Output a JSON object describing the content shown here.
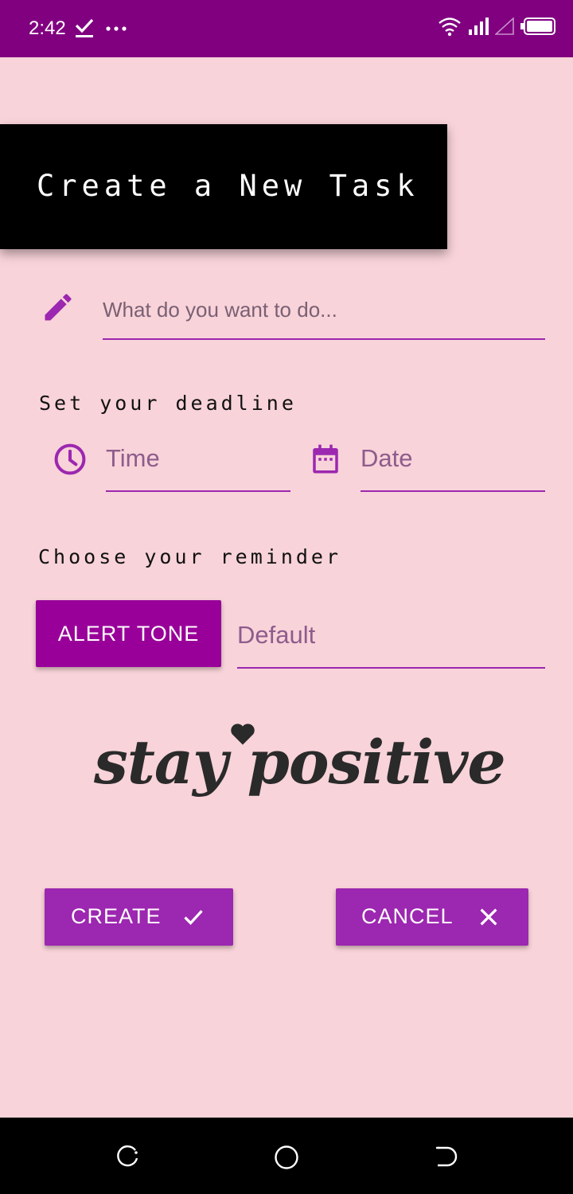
{
  "status_bar": {
    "time": "2:42",
    "icons": [
      "check-download-icon",
      "more-dots-icon",
      "wifi-icon",
      "signal-icon",
      "signal-empty-icon",
      "battery-icon"
    ]
  },
  "header": {
    "title": "Create a New Task"
  },
  "task_input": {
    "placeholder": "What do you want to do...",
    "icon": "pencil-icon"
  },
  "deadline": {
    "label": "Set your deadline",
    "time_placeholder": "Time",
    "date_placeholder": "Date",
    "time_icon": "clock-icon",
    "date_icon": "calendar-icon"
  },
  "reminder": {
    "label": "Choose your reminder",
    "button_label": "ALERT TONE",
    "value": "Default"
  },
  "motto": {
    "text": "stay positive"
  },
  "actions": {
    "create_label": "CREATE",
    "cancel_label": "CANCEL"
  },
  "nav_bar": {
    "icons": [
      "recent-apps-icon",
      "home-icon",
      "back-icon"
    ]
  },
  "colors": {
    "status_bar": "#800080",
    "background": "#F8D3D9",
    "accent": "#9C27B0",
    "alert_button": "#990099",
    "title_banner": "#000000"
  }
}
